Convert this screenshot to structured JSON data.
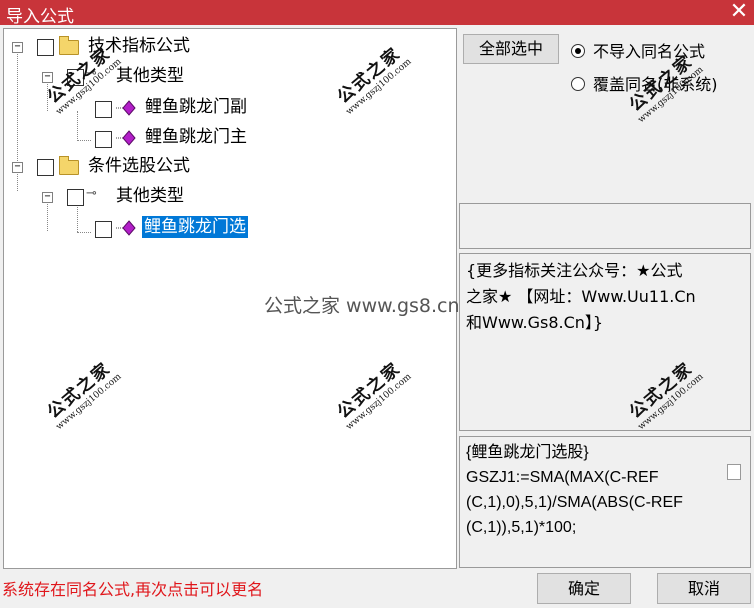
{
  "window": {
    "title": "导入公式",
    "close_glyph": "✕"
  },
  "tree": {
    "items": [
      {
        "label": "技术指标公式",
        "expander": "−"
      },
      {
        "label": "其他类型",
        "expander": "−"
      },
      {
        "label": "鲤鱼跳龙门副"
      },
      {
        "label": "鲤鱼跳龙门主"
      },
      {
        "label": "条件选股公式",
        "expander": "−"
      },
      {
        "label": "其他类型",
        "expander": "−"
      },
      {
        "label": "鲤鱼跳龙门选",
        "selected": true
      }
    ]
  },
  "controls": {
    "select_all_label": "全部选中",
    "radio_no_import_label": "不导入同名公式",
    "radio_overwrite_label": "覆盖同名(非系统)",
    "selected_radio": "不导入同名公式"
  },
  "description": "{更多指标关注公众号：★公式\n之家★ 【网址：Www.Uu11.Cn\n和Www.Gs8.Cn】}",
  "code": "{鲤鱼跳龙门选股}\nGSZJ1:=SMA(MAX(C-REF\n(C,1),0),5,1)/SMA(ABS(C-REF\n(C,1)),5,1)*100;",
  "status_message": "系统存在同名公式,再次点击可以更名",
  "buttons": {
    "ok_label": "确定",
    "cancel_label": "取消"
  },
  "watermark": {
    "main": "公式之家",
    "url": "www.gszj100.com",
    "center_text": "公式之家 www.gs8.cn"
  },
  "icons": {
    "folder": "folder-icon",
    "formula": "gem-icon",
    "category": "key-icon",
    "gem_color": "#b21fc8"
  },
  "colors": {
    "titlebar": "#c8343a",
    "selection": "#0078d7",
    "status_text": "#e0161b"
  }
}
